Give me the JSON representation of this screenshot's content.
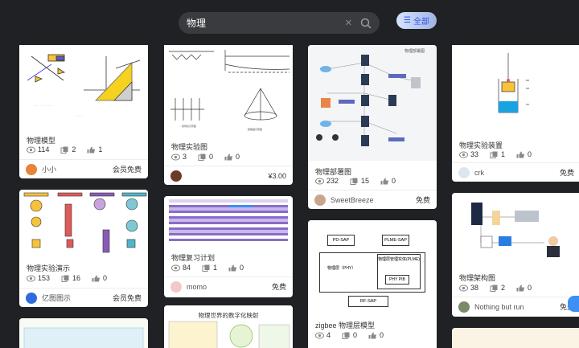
{
  "search": {
    "value": "物理",
    "clear_icon": "close-icon",
    "search_icon": "search-icon"
  },
  "filter": {
    "label": "全部",
    "icon": "list-icon"
  },
  "cards": [
    {
      "title": "物理模型",
      "views": "114",
      "copies": "2",
      "likes": "1",
      "author": "小小",
      "price": "会员免费",
      "avatar_color": "#e8833a"
    },
    {
      "title": "物理实验图",
      "views": "3",
      "copies": "0",
      "likes": "0",
      "author": "",
      "price": "¥3.00",
      "avatar_color": "#6b3a2a"
    },
    {
      "title": "物理部署图",
      "views": "232",
      "copies": "15",
      "likes": "0",
      "author": "SweetBreeze",
      "price": "免费",
      "avatar_color": "#c9a58f",
      "thumb_caption": "物理部署图"
    },
    {
      "title": "物理实验装置",
      "views": "33",
      "copies": "1",
      "likes": "0",
      "author": "crk",
      "price": "免费",
      "avatar_color": "#dfe6ee"
    },
    {
      "title": "物理实验演示",
      "views": "153",
      "copies": "16",
      "likes": "0",
      "author": "亿图图示",
      "price": "会员免费",
      "avatar_color": "#2f6bdc"
    },
    {
      "title": "物理复习计划",
      "views": "84",
      "copies": "1",
      "likes": "0",
      "author": "momo",
      "price": "免费",
      "avatar_color": "#f2c9c9"
    },
    {
      "title": "zigbee 物理层模型",
      "views": "4",
      "copies": "0",
      "likes": "0",
      "diagram": {
        "pd": "PD-SAP",
        "plme": "PLME-SAP",
        "layer": "物理层（PHY）",
        "mgmt": "物理层管理实体(PLME)",
        "pib": "PHY PIB",
        "rf": "RF-SAP"
      }
    },
    {
      "title": "物理架构图",
      "views": "38",
      "copies": "2",
      "likes": "0",
      "author": "Nothing but run",
      "price": "免费",
      "avatar_color": "#7a8a6a"
    },
    {
      "title": "",
      "thumb_caption": "物理世界的数字化映射"
    }
  ]
}
